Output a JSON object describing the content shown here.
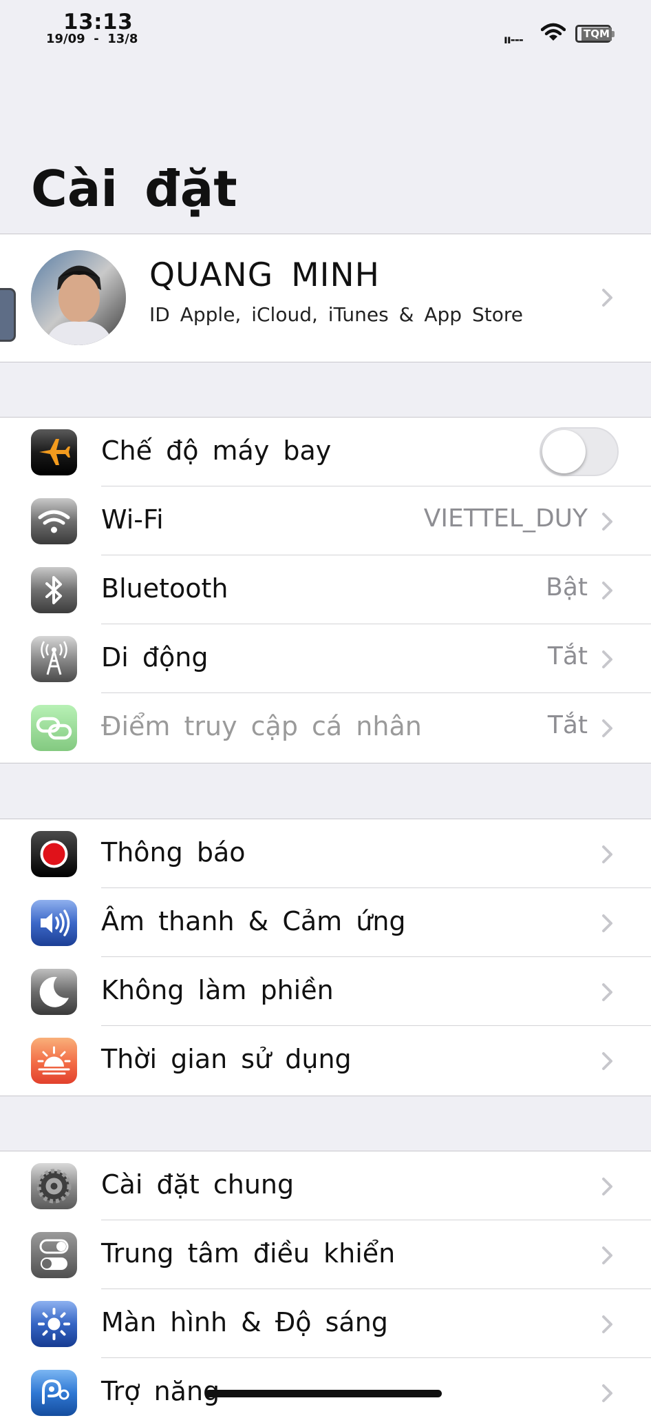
{
  "status_bar": {
    "time": "13:13",
    "date": "19/09  -  13/8",
    "signal": "ıı---",
    "battery_label": "TQM"
  },
  "header": {
    "title": "Cài đặt"
  },
  "profile": {
    "name": "QUANG MINH",
    "subtitle": "ID Apple, iCloud, iTunes & App Store"
  },
  "section1": [
    {
      "label": "Chế độ máy bay",
      "value": "",
      "icon": "airplane-icon",
      "toggle_on": false
    },
    {
      "label": "Wi-Fi",
      "value": "VIETTEL_DUY",
      "icon": "wifi-icon"
    },
    {
      "label": "Bluetooth",
      "value": "Bật",
      "icon": "bluetooth-icon"
    },
    {
      "label": "Di động",
      "value": "Tắt",
      "icon": "antenna-icon"
    },
    {
      "label": "Điểm truy cập cá nhân",
      "value": "Tắt",
      "icon": "link-icon"
    }
  ],
  "section2": [
    {
      "label": "Thông báo",
      "icon": "notification-icon"
    },
    {
      "label": "Âm thanh & Cảm ứng",
      "icon": "speaker-icon"
    },
    {
      "label": "Không làm phiền",
      "icon": "moon-icon"
    },
    {
      "label": "Thời gian sử dụng",
      "icon": "sunset-icon"
    }
  ],
  "section3": [
    {
      "label": "Cài đặt chung",
      "icon": "gear-icon"
    },
    {
      "label": "Trung tâm điều khiển",
      "icon": "switches-icon"
    },
    {
      "label": "Màn hình & Độ sáng",
      "icon": "brightness-icon"
    },
    {
      "label": "Trợ năng",
      "icon": "accessibility-icon"
    }
  ]
}
